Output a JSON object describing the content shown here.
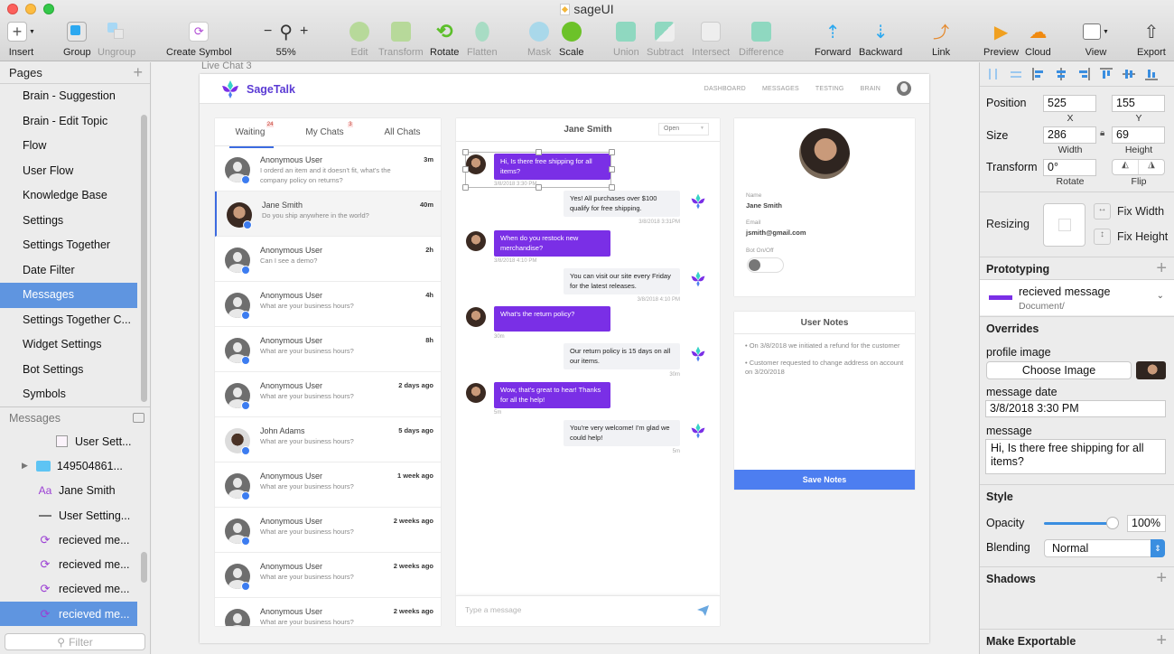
{
  "window": {
    "title": "sageUI"
  },
  "toolbar": {
    "insert": "Insert",
    "group": "Group",
    "ungroup": "Ungroup",
    "create_symbol": "Create Symbol",
    "zoom_level": "55%",
    "edit": "Edit",
    "transform": "Transform",
    "rotate": "Rotate",
    "flatten": "Flatten",
    "mask": "Mask",
    "scale": "Scale",
    "union": "Union",
    "subtract": "Subtract",
    "intersect": "Intersect",
    "difference": "Difference",
    "forward": "Forward",
    "backward": "Backward",
    "link": "Link",
    "preview": "Preview",
    "cloud": "Cloud",
    "view": "View",
    "export": "Export"
  },
  "pages": {
    "title": "Pages",
    "items": [
      "Brain - Suggestion",
      "Brain - Edit Topic",
      "Flow",
      "User Flow",
      "Knowledge Base",
      "Settings",
      "Settings Together",
      "Date Filter",
      "Messages",
      "Settings Together C...",
      "Widget Settings",
      "Bot Settings",
      "Symbols"
    ],
    "selected": "Messages"
  },
  "layers": {
    "title": "Messages",
    "items": [
      {
        "label": "User Sett...",
        "icon": "artboard-icon"
      },
      {
        "label": "149504861...",
        "icon": "folder-icon"
      },
      {
        "label": "Jane Smith",
        "icon": "text-icon"
      },
      {
        "label": "User Setting...",
        "icon": "line-icon"
      },
      {
        "label": "recieved me...",
        "icon": "symbol-icon"
      },
      {
        "label": "recieved me...",
        "icon": "symbol-icon"
      },
      {
        "label": "recieved me...",
        "icon": "symbol-icon"
      },
      {
        "label": "recieved me...",
        "icon": "symbol-icon",
        "selected": true
      }
    ],
    "filter_placeholder": "Filter"
  },
  "artboard": {
    "label": "Live Chat 3",
    "brand": "SageTalk",
    "nav": [
      "DASHBOARD",
      "MESSAGES",
      "TESTING",
      "BRAIN"
    ],
    "tabs": [
      {
        "label": "Waiting",
        "badge": "24",
        "active": true
      },
      {
        "label": "My Chats",
        "badge": "3"
      },
      {
        "label": "All Chats"
      }
    ],
    "chats": [
      {
        "name": "Anonymous User",
        "message": "I orderd an item and it doesn't fit, what's the company policy on returns?",
        "time": "3m"
      },
      {
        "name": "Jane Smith",
        "message": "Do you ship anywhere in the world?",
        "time": "40m",
        "selected": true,
        "photo": true
      },
      {
        "name": "Anonymous User",
        "message": "Can I see a demo?",
        "time": "2h"
      },
      {
        "name": "Anonymous User",
        "message": "What are your business hours?",
        "time": "4h"
      },
      {
        "name": "Anonymous User",
        "message": "What are your business hours?",
        "time": "8h"
      },
      {
        "name": "Anonymous User",
        "message": "What are your business hours?",
        "time": "2 days ago"
      },
      {
        "name": "John Adams",
        "message": "What are your business hours?",
        "time": "5 days ago",
        "photo2": true
      },
      {
        "name": "Anonymous User",
        "message": "What are your business hours?",
        "time": "1 week ago"
      },
      {
        "name": "Anonymous User",
        "message": "What are your business hours?",
        "time": "2 weeks ago"
      },
      {
        "name": "Anonymous User",
        "message": "What are your business hours?",
        "time": "2 weeks ago"
      },
      {
        "name": "Anonymous User",
        "message": "What are your business hours?",
        "time": "2 weeks ago"
      }
    ],
    "conversation": {
      "title": "Jane Smith",
      "status": "Open",
      "messages": [
        {
          "dir": "in",
          "text": "Hi, Is there free shipping for all items?",
          "time": "3/8/2018 3:30 PM"
        },
        {
          "dir": "out",
          "text": "Yes! All purchases over $100 qualify for free shipping.",
          "time": "3/8/2018 3:31PM"
        },
        {
          "dir": "in",
          "text": "When do you restock new merchandise?",
          "time": "3/8/2018 4:10 PM"
        },
        {
          "dir": "out",
          "text": "You can visit our site every Friday for the latest releases.",
          "time": "3/8/2018 4:10 PM"
        },
        {
          "dir": "in",
          "text": "What's the return policy?",
          "time": "30m"
        },
        {
          "dir": "out",
          "text": "Our return policy is 15 days on all our items.",
          "time": "30m"
        },
        {
          "dir": "in",
          "text": "Wow, that's great to hear! Thanks for all the help!",
          "time": "5m"
        },
        {
          "dir": "out",
          "text": "You're very welcome! I'm glad we could help!",
          "time": "5m"
        }
      ],
      "composer_placeholder": "Type a message"
    },
    "profile": {
      "name_label": "Name",
      "name": "Jane Smith",
      "email_label": "Email",
      "email": "jsmith@gmail.com",
      "bot_label": "Bot On/Off",
      "bot_on": false
    },
    "notes": {
      "title": "User Notes",
      "items": [
        "• On 3/8/2018 we initiated a refund for the customer",
        "• Customer requested to change address on account on 3/20/2018"
      ],
      "save": "Save Notes"
    }
  },
  "inspector": {
    "position_label": "Position",
    "x": "525",
    "y": "155",
    "x_label": "X",
    "y_label": "Y",
    "size_label": "Size",
    "width": "286",
    "height": "69",
    "width_label": "Width",
    "height_label": "Height",
    "transform_label": "Transform",
    "rotate": "0°",
    "rotate_label": "Rotate",
    "flip_label": "Flip",
    "resizing_label": "Resizing",
    "fix_width": "Fix Width",
    "fix_height": "Fix Height",
    "prototyping": "Prototyping",
    "symbol_name": "recieved message",
    "symbol_path": "Document/",
    "overrides": "Overrides",
    "profile_image_label": "profile image",
    "choose_image": "Choose Image",
    "message_date_label": "message date",
    "message_date": "3/8/2018 3:30 PM",
    "message_label": "message",
    "message": "Hi, Is there free shipping for all items?",
    "style": "Style",
    "opacity_label": "Opacity",
    "opacity": "100%",
    "opacity_value": 1.0,
    "blending_label": "Blending",
    "blending": "Normal",
    "shadows": "Shadows",
    "make_exportable": "Make Exportable"
  },
  "colors": {
    "accent": "#7a2fe6",
    "primary": "#4d7ef0",
    "selection": "#5f95e0"
  }
}
